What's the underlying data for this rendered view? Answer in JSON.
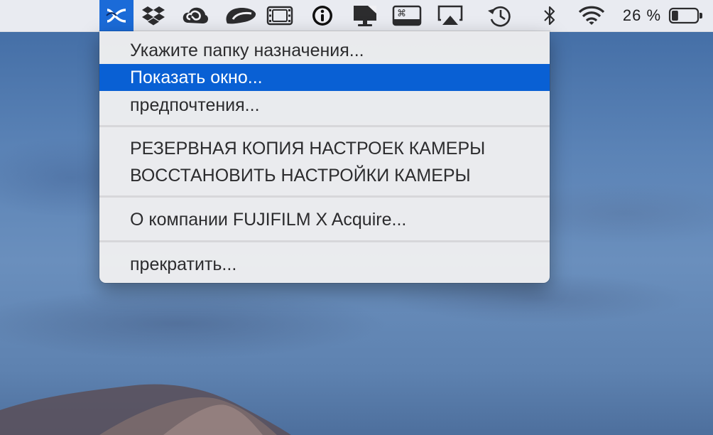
{
  "menubar": {
    "battery_percent": "26 %",
    "battery_level": 0.26,
    "icons": [
      "fujifilm-x-acquire-icon",
      "dropbox-icon",
      "creative-cloud-icon",
      "cloud-app-icon",
      "film-strip-icon",
      "info-dot-icon",
      "display-mirroring-icon",
      "keyboard-shortcut-icon",
      "airplay-icon",
      "time-machine-icon",
      "bluetooth-icon",
      "wifi-icon",
      "battery-icon"
    ],
    "active_color": "#1b6bd8"
  },
  "menu": {
    "items": [
      {
        "label": "Укажите папку назначения..."
      },
      {
        "label": "Показать окно..."
      },
      {
        "label": "предпочтения..."
      },
      {
        "label": "РЕЗЕРВНАЯ КОПИЯ НАСТРОЕК КАМЕРЫ"
      },
      {
        "label": "ВОССТАНОВИТЬ НАСТРОЙКИ КАМЕРЫ"
      },
      {
        "label": "О компании FUJIFILM X Acquire..."
      },
      {
        "label": "прекратить..."
      }
    ],
    "selected_index": 1,
    "highlight_color": "#0960d4"
  }
}
